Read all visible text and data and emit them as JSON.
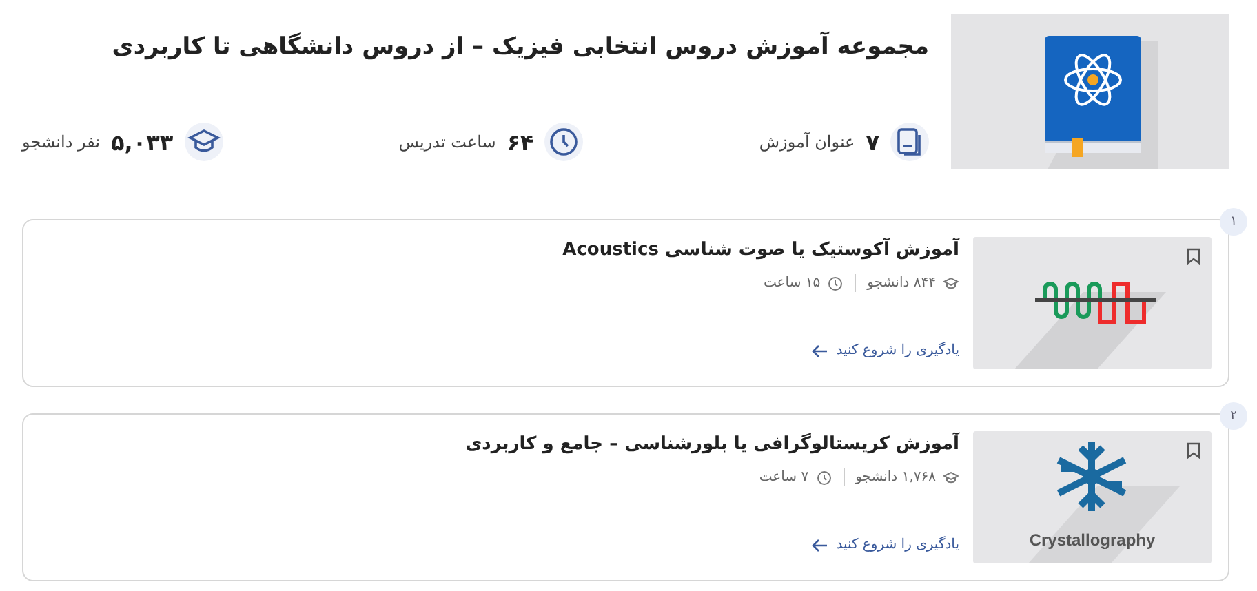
{
  "header": {
    "title": "مجموعه آموزش دروس انتخابی فیزیک – از دروس دانشگاهی تا کاربردی",
    "cover": {
      "kind": "book"
    }
  },
  "stats": [
    {
      "kind": "courses",
      "value": "۷",
      "label": "عنوان آموزش"
    },
    {
      "kind": "hours",
      "value": "۶۴",
      "label": "ساعت تدریس"
    },
    {
      "kind": "students",
      "value": "۵,۰۳۳",
      "label": "نفر دانشجو"
    }
  ],
  "courses": [
    {
      "number": "۱",
      "title": "آموزش آکوستیک یا صوت شناسی Acoustics",
      "students": "۸۴۴ دانشجو",
      "hours": "۱۵ ساعت",
      "cta": "یادگیری را شروع کنید",
      "thumb": {
        "kind": "wave"
      }
    },
    {
      "number": "۲",
      "title": "آموزش کریستالوگرافی یا بلورشناسی – جامع و کاربردی",
      "students": "۱,۷۶۸ دانشجو",
      "hours": "۷ ساعت",
      "cta": "یادگیری را شروع کنید",
      "thumb": {
        "kind": "snowflake",
        "caption": "Crystallography"
      }
    }
  ]
}
